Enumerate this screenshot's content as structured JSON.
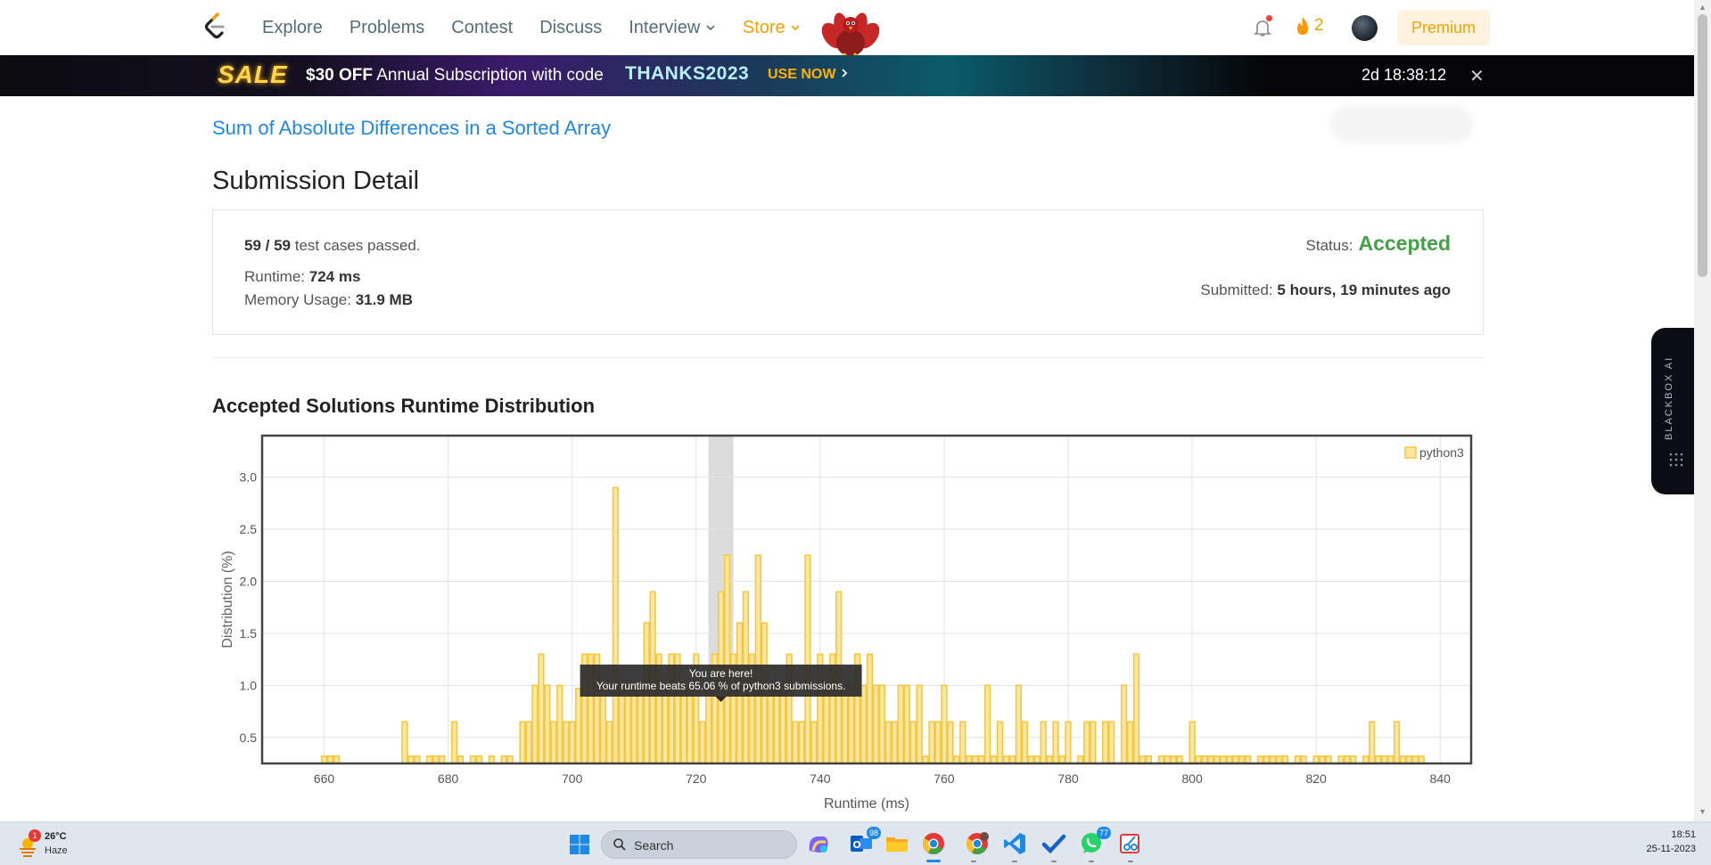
{
  "nav": {
    "links": [
      "Explore",
      "Problems",
      "Contest",
      "Discuss",
      "Interview",
      "Store"
    ],
    "streak_count": "2",
    "premium_label": "Premium"
  },
  "banner": {
    "sale": "SALE",
    "offer_amount": "$30 OFF",
    "offer_text": "Annual Subscription with code",
    "code": "THANKS2023",
    "cta": "USE NOW",
    "timer": "2d 18:38:12"
  },
  "problem": {
    "link_text": "Sum of Absolute Differences in a Sorted Array"
  },
  "submission": {
    "title": "Submission Detail",
    "cases_passed": "59 / 59",
    "cases_suffix": "test cases passed.",
    "runtime_label": "Runtime:",
    "runtime_value": "724 ms",
    "memory_label": "Memory Usage:",
    "memory_value": "31.9 MB",
    "status_label": "Status:",
    "status_value": "Accepted",
    "submitted_label": "Submitted:",
    "submitted_value": "5 hours, 19 minutes ago"
  },
  "distribution": {
    "section_title": "Accepted Solutions Runtime Distribution"
  },
  "chart_data": {
    "type": "bar",
    "xlabel": "Runtime (ms)",
    "ylabel": "Distribution (%)",
    "xlim": [
      650,
      845
    ],
    "ylim": [
      0.25,
      3.4
    ],
    "xticks": [
      660,
      680,
      700,
      720,
      740,
      760,
      780,
      800,
      820,
      840
    ],
    "yticks": [
      0.5,
      1.0,
      1.5,
      2.0,
      2.5,
      3.0
    ],
    "legend": "top-right",
    "grid": true,
    "series": [
      {
        "name": "python3",
        "color": "#f5c842",
        "x": [
          660,
          661,
          662,
          673,
          674,
          675,
          677,
          678,
          679,
          681,
          682,
          684,
          685,
          687,
          689,
          690,
          692,
          693,
          694,
          695,
          696,
          697,
          698,
          699,
          700,
          701,
          702,
          703,
          704,
          705,
          706,
          707,
          708,
          709,
          710,
          711,
          712,
          713,
          714,
          715,
          716,
          717,
          718,
          719,
          720,
          721,
          722,
          723,
          724,
          725,
          726,
          727,
          728,
          729,
          730,
          731,
          732,
          733,
          734,
          735,
          736,
          737,
          738,
          739,
          740,
          741,
          742,
          743,
          744,
          745,
          746,
          747,
          748,
          749,
          750,
          751,
          752,
          753,
          754,
          755,
          756,
          757,
          758,
          759,
          760,
          761,
          762,
          763,
          764,
          765,
          766,
          767,
          768,
          769,
          770,
          771,
          772,
          773,
          774,
          775,
          776,
          777,
          778,
          779,
          780,
          782,
          783,
          784,
          786,
          787,
          789,
          790,
          791,
          792,
          793,
          795,
          796,
          797,
          798,
          800,
          801,
          802,
          803,
          804,
          805,
          806,
          807,
          808,
          809,
          811,
          812,
          813,
          814,
          815,
          817,
          818,
          820,
          821,
          822,
          824,
          825,
          826,
          828,
          829,
          830,
          831,
          832,
          833,
          834,
          835,
          836,
          837
        ],
        "values": [
          0.32,
          0.32,
          0.32,
          0.65,
          0.32,
          0.32,
          0.32,
          0.32,
          0.32,
          0.65,
          0.32,
          0.32,
          0.32,
          0.32,
          0.32,
          0.32,
          0.65,
          0.65,
          1.0,
          1.3,
          1.0,
          0.65,
          1.0,
          0.65,
          0.65,
          0.97,
          1.3,
          1.3,
          1.3,
          1.0,
          0.65,
          2.9,
          1.0,
          1.0,
          1.0,
          1.0,
          1.6,
          1.9,
          1.3,
          1.0,
          1.3,
          1.3,
          1.0,
          1.0,
          1.3,
          0.65,
          1.0,
          1.3,
          1.9,
          2.25,
          1.3,
          1.6,
          1.9,
          1.3,
          2.25,
          1.6,
          1.0,
          1.0,
          1.0,
          1.3,
          0.65,
          0.65,
          2.25,
          0.65,
          1.3,
          1.0,
          1.3,
          1.9,
          1.0,
          1.0,
          1.3,
          1.0,
          1.3,
          1.0,
          1.0,
          0.65,
          0.65,
          1.0,
          1.0,
          0.65,
          1.0,
          0.32,
          0.65,
          0.65,
          1.0,
          0.65,
          0.32,
          0.65,
          0.32,
          0.32,
          0.32,
          1.0,
          0.32,
          0.65,
          0.32,
          0.32,
          1.0,
          0.65,
          0.32,
          0.32,
          0.65,
          0.32,
          0.65,
          0.32,
          0.65,
          0.32,
          0.65,
          0.65,
          0.65,
          0.65,
          1.0,
          0.65,
          1.3,
          0.32,
          0.32,
          0.32,
          0.32,
          0.32,
          0.32,
          0.65,
          0.32,
          0.32,
          0.32,
          0.32,
          0.32,
          0.32,
          0.32,
          0.32,
          0.32,
          0.32,
          0.32,
          0.32,
          0.32,
          0.32,
          0.32,
          0.32,
          0.32,
          0.32,
          0.32,
          0.32,
          0.32,
          0.32,
          0.32,
          0.65,
          0.32,
          0.32,
          0.32,
          0.65,
          0.32,
          0.32,
          0.32,
          0.32
        ]
      }
    ],
    "highlight_x": 724,
    "tooltip_title": "You are here!",
    "tooltip_text": "Your runtime beats 65.06 % of python3 submissions."
  },
  "blackbox": {
    "label": "BLACKBOX AI"
  },
  "taskbar": {
    "weather_temp": "26°C",
    "weather_condition": "Haze",
    "weather_badge": "1",
    "search_placeholder": "Search",
    "outlook_badge": "98",
    "whatsapp_badge": "77",
    "time": "18:51",
    "date": "25-11-2023"
  }
}
